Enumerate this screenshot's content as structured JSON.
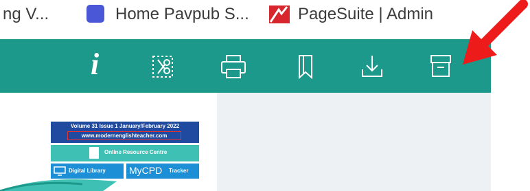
{
  "bookmarks": {
    "item1_label": "ng   V...",
    "item2_label": "Home   Pavpub   S...",
    "item3_label": "PageSuite | Admin"
  },
  "toolbar": {
    "color": "#1c998a",
    "icons": [
      "info-icon",
      "clip-icon",
      "print-icon",
      "bookmark-icon",
      "download-icon",
      "archive-icon"
    ]
  },
  "cover": {
    "header_line": "Volume 31   Issue 1   January/February 2022",
    "url": "www.modernenglishteacher.com",
    "resource_label": "Online Resource Centre",
    "library_label": "Digital Library",
    "mycpd_label": "MyCPD",
    "tracker_label": "Tracker"
  },
  "annotation": {
    "arrow_color": "#ee1b1b"
  }
}
